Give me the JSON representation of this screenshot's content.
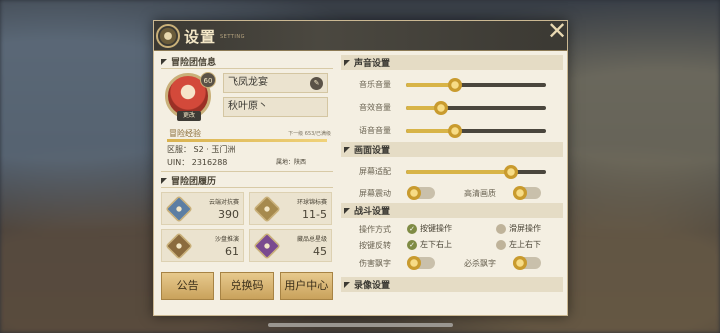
{
  "title": {
    "main": "设置",
    "sub": "SETTING"
  },
  "close_icon": "close-icon",
  "left": {
    "team_info_header": "冒险团信息",
    "level": "60",
    "change_label": "更改",
    "name": "飞凤龙宴",
    "signature": "秋叶原丶",
    "exp_label": "冒险经验",
    "exp_progress_text": "下一级 653/已满级",
    "exp_fraction": 1.0,
    "server": "区服： S2 · 玉门洲",
    "uin": "UIN： 2316288",
    "location": "属地：陕西",
    "history_header": "冒险团履历",
    "records": [
      {
        "name": "云端对抗赛",
        "value": "390",
        "color": "#5c7ea3"
      },
      {
        "name": "环球锦标赛",
        "value": "11-5",
        "color": "#a68a4e"
      },
      {
        "name": "沙盘推演",
        "value": "61",
        "color": "#8b6b3d"
      },
      {
        "name": "藏品总星级",
        "value": "45",
        "color": "#7a4a8f"
      }
    ],
    "buttons": [
      "公告",
      "兑换码",
      "用户中心"
    ]
  },
  "right": {
    "sound": {
      "header": "声音设置",
      "sliders": [
        {
          "label": "音乐音量",
          "value": 0.35
        },
        {
          "label": "音效音量",
          "value": 0.25
        },
        {
          "label": "语音音量",
          "value": 0.35
        }
      ]
    },
    "display": {
      "header": "画面设置",
      "slider": {
        "label": "屏幕适配",
        "value": 0.75
      },
      "shake_label": "屏幕震动",
      "hd_label": "高清画质"
    },
    "battle": {
      "header": "战斗设置",
      "mode_label": "操作方式",
      "mode_options": [
        "按键操作",
        "滑屏操作"
      ],
      "reverse_label": "按键反转",
      "reverse_options": [
        "左下右上",
        "左上右下"
      ],
      "damage_label": "伤害飘字",
      "kill_label": "必杀飘字"
    },
    "record": {
      "header": "录像设置"
    }
  }
}
